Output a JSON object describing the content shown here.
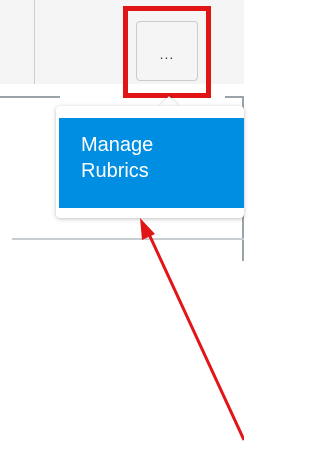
{
  "toolbar": {
    "more_button_label": "..."
  },
  "menu": {
    "items": [
      {
        "label": "Manage\nRubrics"
      }
    ]
  },
  "annotation": {
    "color": "#e11515"
  },
  "colors": {
    "accent": "#008ee2",
    "highlight": "#e11515"
  }
}
